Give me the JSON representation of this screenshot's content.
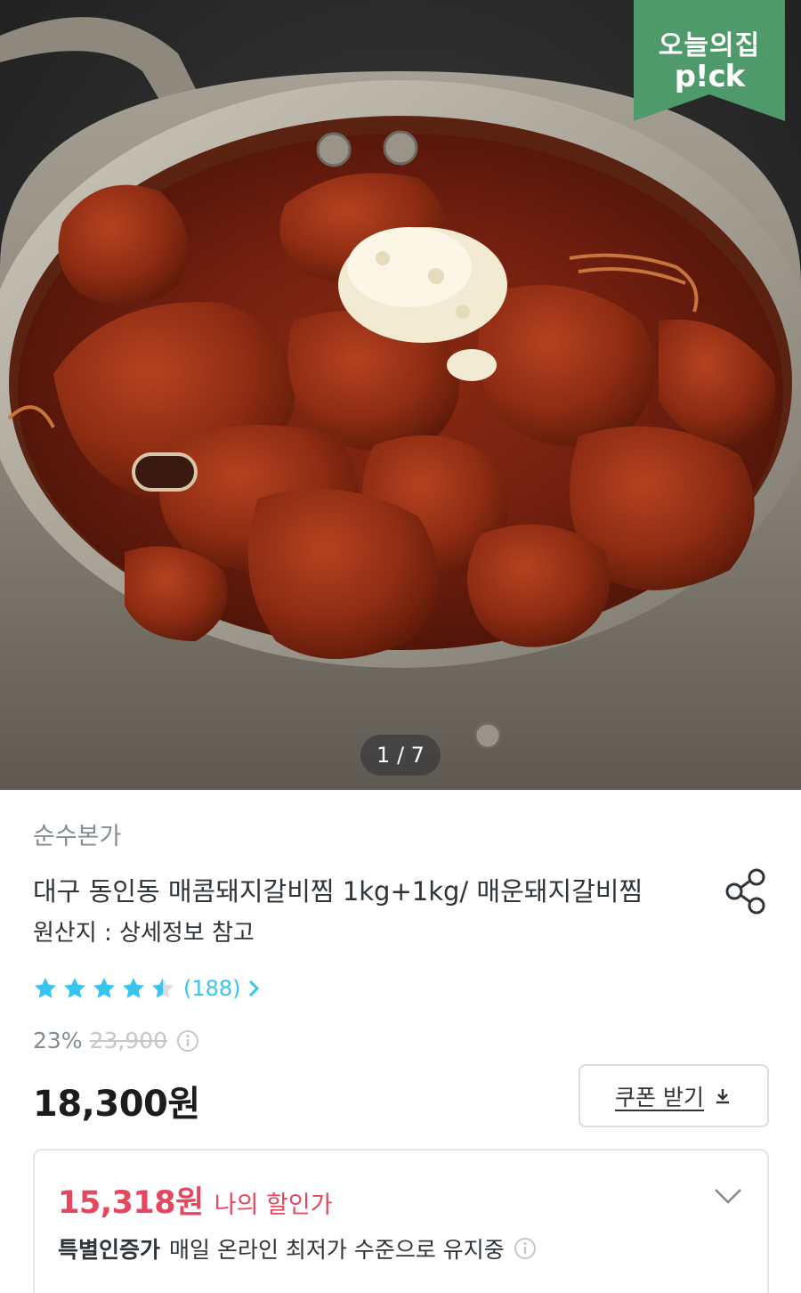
{
  "hero": {
    "counter": "1 / 7",
    "badge": {
      "line1": "오늘의집",
      "line2": "p!ck",
      "color": "#4f9a6a"
    }
  },
  "product": {
    "brand": "순수본가",
    "title": "대구 동인동 매콤돼지갈비찜 1kg+1kg/ 매운돼지갈비찜",
    "origin": "원산지 : 상세정보 참고",
    "rating": {
      "value": 4.5,
      "max": 5,
      "review_count": "(188)",
      "star_color": "#35c5f0"
    },
    "discount_rate": "23%",
    "original_price": "23,900",
    "price": "18,300원",
    "coupon_button": "쿠폰 받기"
  },
  "benefit": {
    "my_price": "15,318원",
    "my_price_label": "나의 할인가",
    "special_label": "특별인증가",
    "special_desc": "매일 온라인 최저가 수준으로 유지중",
    "accent_color": "#e3485f"
  },
  "icons": [
    "share-icon",
    "star-icon",
    "chevron-right-icon",
    "info-icon",
    "download-icon",
    "chevron-down-icon"
  ]
}
